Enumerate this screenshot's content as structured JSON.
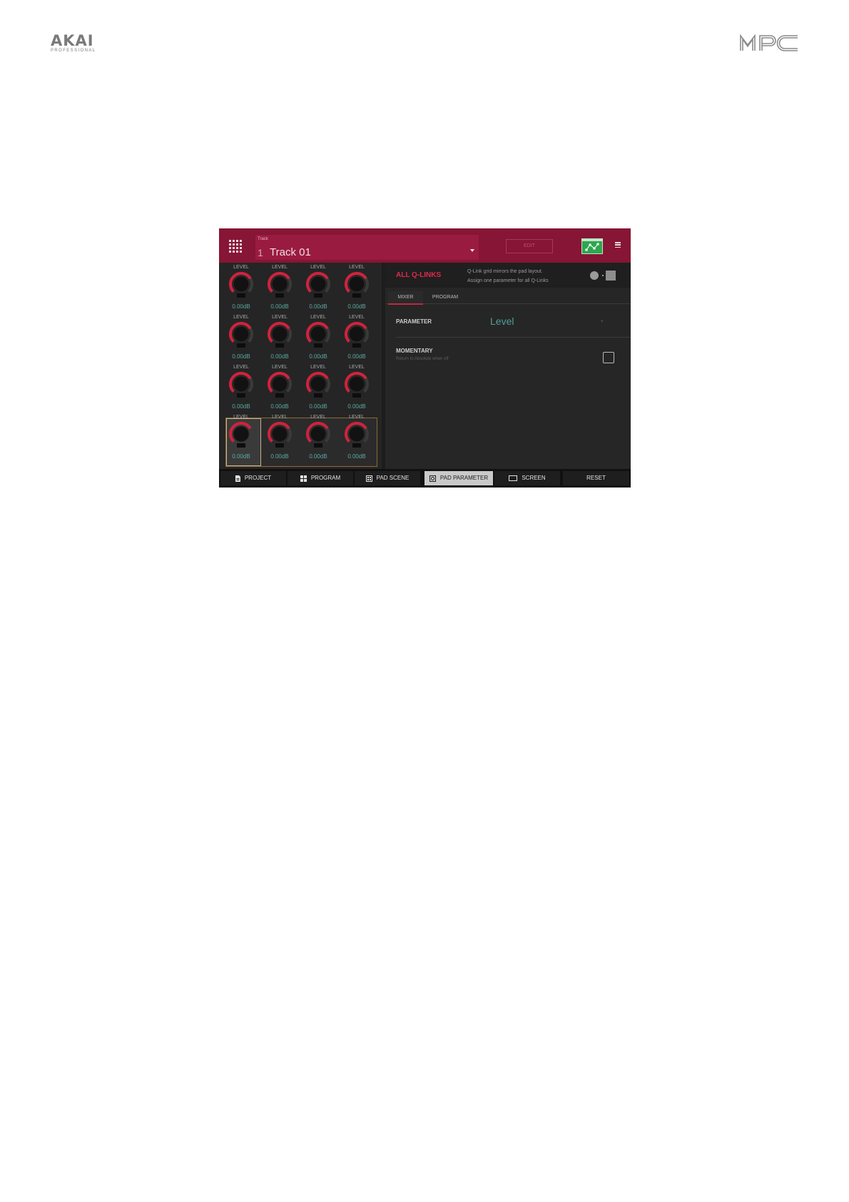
{
  "header": {
    "brand_left_text": "AKAI",
    "brand_left_sub": "PROFESSIONAL",
    "brand_right_text": "MPC"
  },
  "topbar": {
    "track_caption": "Track",
    "track_number": "1",
    "track_name": "Track 01",
    "edit_label": "EDIT",
    "menu_icon": "menu-icon",
    "automation_icon": "automation-icon",
    "grid_icon": "grid-icon",
    "accent_color": "#871535"
  },
  "knobs": [
    {
      "label": "LEVEL",
      "value": "0.00dB"
    },
    {
      "label": "LEVEL",
      "value": "0.00dB"
    },
    {
      "label": "LEVEL",
      "value": "0.00dB"
    },
    {
      "label": "LEVEL",
      "value": "0.00dB"
    },
    {
      "label": "LEVEL",
      "value": "0.00dB"
    },
    {
      "label": "LEVEL",
      "value": "0.00dB"
    },
    {
      "label": "LEVEL",
      "value": "0.00dB"
    },
    {
      "label": "LEVEL",
      "value": "0.00dB"
    },
    {
      "label": "LEVEL",
      "value": "0.00dB"
    },
    {
      "label": "LEVEL",
      "value": "0.00dB"
    },
    {
      "label": "LEVEL",
      "value": "0.00dB"
    },
    {
      "label": "LEVEL",
      "value": "0.00dB"
    },
    {
      "label": "LEVEL",
      "value": "0.00dB"
    },
    {
      "label": "LEVEL",
      "value": "0.00dB"
    },
    {
      "label": "LEVEL",
      "value": "0.00dB"
    },
    {
      "label": "LEVEL",
      "value": "0.00dB"
    }
  ],
  "knob_level_fraction": 0.72,
  "panel": {
    "title": "ALL Q-LINKS",
    "desc_line1": "Q-Link grid mirrors the pad layout.",
    "desc_line2": "Assign one parameter for all Q-Links",
    "tabs": [
      "MIXER",
      "PROGRAM"
    ],
    "active_tab": "MIXER",
    "parameter_label": "PARAMETER",
    "parameter_value": "Level",
    "momentary_label": "MOMENTARY",
    "momentary_sub": "Return to Absolute when off",
    "momentary_checked": false
  },
  "bottombar": {
    "buttons": [
      {
        "label": "PROJECT",
        "icon": "document-icon"
      },
      {
        "label": "PROGRAM",
        "icon": "grid-four-icon"
      },
      {
        "label": "PAD SCENE",
        "icon": "pad-scene-icon"
      },
      {
        "label": "PAD PARAMETER",
        "icon": "pad-parameter-icon"
      },
      {
        "label": "SCREEN",
        "icon": "screen-icon"
      },
      {
        "label": "RESET",
        "icon": ""
      }
    ],
    "active": "PAD PARAMETER"
  },
  "colors": {
    "knob_arc": "#d0223d",
    "value_text": "#5ba9a0",
    "panel_title": "#e0294d",
    "automation_green": "#2ea64e"
  }
}
